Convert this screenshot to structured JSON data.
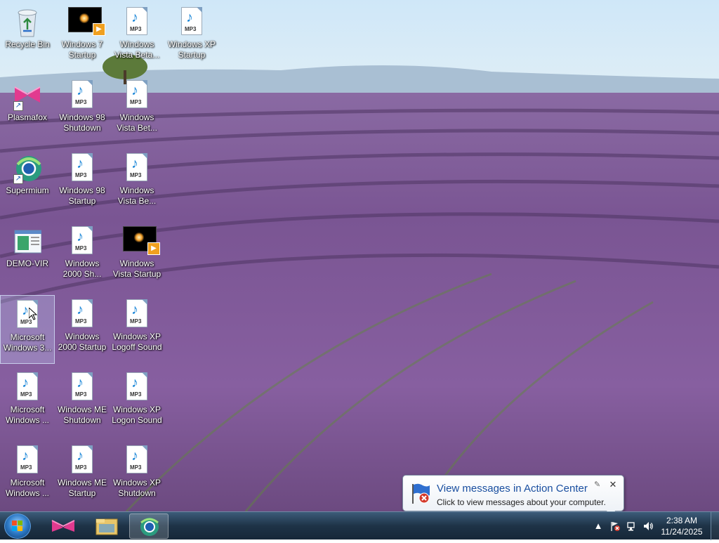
{
  "desktop": {
    "icons": [
      {
        "label": "Recycle Bin",
        "type": "recyclebin",
        "col": 0,
        "row": 0
      },
      {
        "label": "Windows 7 Startup",
        "type": "video",
        "col": 1,
        "row": 0
      },
      {
        "label": "Windows Vista Beta...",
        "type": "mp3",
        "col": 2,
        "row": 0
      },
      {
        "label": "Windows XP Startup",
        "type": "mp3",
        "col": 3,
        "row": 0
      },
      {
        "label": "Plasmafox",
        "type": "plasmafox",
        "col": 0,
        "row": 1
      },
      {
        "label": "Windows 98 Shutdown",
        "type": "mp3",
        "col": 1,
        "row": 1
      },
      {
        "label": "Windows Vista Bet...",
        "type": "mp3",
        "col": 2,
        "row": 1
      },
      {
        "label": "Supermium",
        "type": "supermium",
        "col": 0,
        "row": 2
      },
      {
        "label": "Windows 98 Startup",
        "type": "mp3",
        "col": 1,
        "row": 2
      },
      {
        "label": "Windows Vista Be...",
        "type": "mp3",
        "col": 2,
        "row": 2
      },
      {
        "label": "DEMO-VIR",
        "type": "window",
        "col": 0,
        "row": 3
      },
      {
        "label": "Windows 2000 Sh...",
        "type": "mp3",
        "col": 1,
        "row": 3
      },
      {
        "label": "Windows Vista Startup",
        "type": "video",
        "col": 2,
        "row": 3
      },
      {
        "label": "Microsoft Windows 3...",
        "type": "mp3",
        "col": 0,
        "row": 4,
        "selected": true
      },
      {
        "label": "Windows 2000 Startup",
        "type": "mp3",
        "col": 1,
        "row": 4
      },
      {
        "label": "Windows XP Logoff Sound",
        "type": "mp3",
        "col": 2,
        "row": 4
      },
      {
        "label": "Microsoft Windows ...",
        "type": "mp3",
        "col": 0,
        "row": 5
      },
      {
        "label": "Windows ME Shutdown",
        "type": "mp3",
        "col": 1,
        "row": 5
      },
      {
        "label": "Windows XP Logon Sound",
        "type": "mp3",
        "col": 2,
        "row": 5
      },
      {
        "label": "Microsoft Windows ...",
        "type": "mp3",
        "col": 0,
        "row": 6
      },
      {
        "label": "Windows ME Startup",
        "type": "mp3",
        "col": 1,
        "row": 6
      },
      {
        "label": "Windows XP Shutdown",
        "type": "mp3",
        "col": 2,
        "row": 6
      }
    ],
    "mp3_tag": "MP3"
  },
  "notification": {
    "title": "View messages in Action Center",
    "body": "Click to view messages about your computer.",
    "close_glyph": "✕"
  },
  "taskbar": {
    "pinned": [
      "start-orb",
      "plasmafox",
      "file-explorer",
      "supermium"
    ],
    "active": "supermium"
  },
  "tray": {
    "time": "2:38 AM",
    "date": "11/24/2025",
    "show_hidden_glyph": "▲"
  },
  "colors": {
    "taskbar": "#1e3347",
    "balloon_title": "#1a4fa0",
    "mp3_note": "#1e88d8"
  }
}
